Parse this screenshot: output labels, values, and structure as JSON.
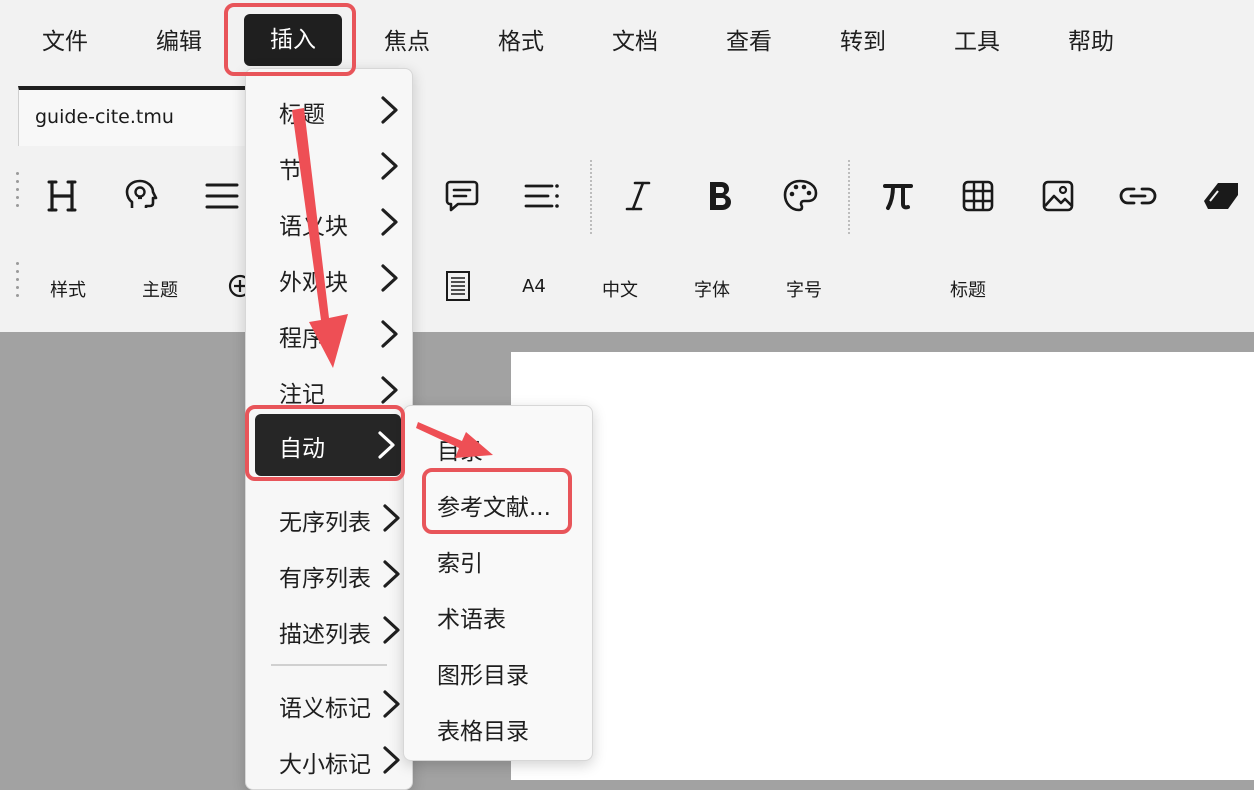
{
  "menubar": {
    "items": [
      {
        "label": "文件"
      },
      {
        "label": "编辑"
      },
      {
        "label": "插入"
      },
      {
        "label": "焦点"
      },
      {
        "label": "格式"
      },
      {
        "label": "文档"
      },
      {
        "label": "查看"
      },
      {
        "label": "转到"
      },
      {
        "label": "工具"
      },
      {
        "label": "帮助"
      }
    ],
    "active_index": 2
  },
  "tab": {
    "title": "guide-cite.tmu"
  },
  "toolbar1": {
    "icons": [
      "heading-icon",
      "brain-idea-icon",
      "align-icon",
      "comment-icon",
      "list-icon",
      "italic-icon",
      "bold-icon",
      "palette-icon",
      "pi-icon",
      "table-icon",
      "image-icon",
      "link-icon",
      "eraser-icon"
    ]
  },
  "toolbar2": {
    "style_label": "样式",
    "theme_label": "主题",
    "a4_label": "A4",
    "lang_label": "中文",
    "font_label": "字体",
    "size_label": "字号",
    "heading_label": "标题"
  },
  "insert_menu": {
    "items": [
      {
        "label": "标题"
      },
      {
        "label": "节"
      },
      {
        "label": "语义块"
      },
      {
        "label": "外观块"
      },
      {
        "label": "程序"
      },
      {
        "label": "注记"
      },
      {
        "label": "自动"
      },
      {
        "label": "无序列表"
      },
      {
        "label": "有序列表"
      },
      {
        "label": "描述列表"
      },
      {
        "label": "语义标记"
      },
      {
        "label": "大小标记"
      }
    ]
  },
  "auto_submenu": {
    "items": [
      {
        "label": "目录"
      },
      {
        "label": "参考文献..."
      },
      {
        "label": "索引"
      },
      {
        "label": "术语表"
      },
      {
        "label": "图形目录"
      },
      {
        "label": "表格目录"
      }
    ]
  },
  "colors": {
    "annotation_red": "#e8555a",
    "menu_active_bg": "#1f1f1f",
    "chrome_bg": "#f2f2f2",
    "canvas_bg": "#a2a2a2"
  }
}
